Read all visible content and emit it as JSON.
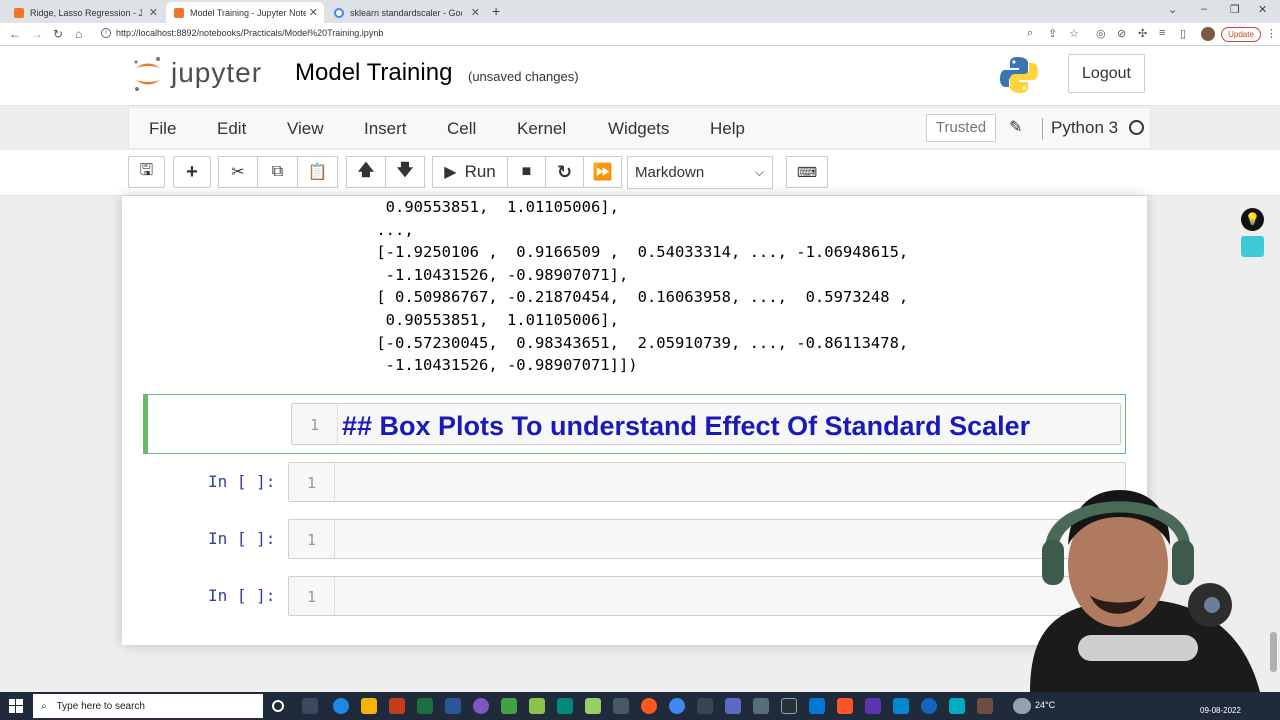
{
  "browser": {
    "tabs": [
      {
        "title": "Ridge, Lasso Regression - Jupyter",
        "active": false
      },
      {
        "title": "Model Training - Jupyter Notebook",
        "active": true
      },
      {
        "title": "sklearn standardscaler - Google S",
        "active": false
      }
    ],
    "url": "http://localhost:8892/notebooks/Practicals/Model%20Training.ipynb",
    "update_label": "Update"
  },
  "header": {
    "logo_text": "jupyter",
    "notebook_title": "Model Training",
    "save_status": "(unsaved changes)",
    "logout_label": "Logout"
  },
  "menubar": {
    "items": [
      "File",
      "Edit",
      "View",
      "Insert",
      "Cell",
      "Kernel",
      "Widgets",
      "Help"
    ],
    "trusted_label": "Trusted",
    "kernel_name": "Python 3"
  },
  "toolbar": {
    "run_label": "Run",
    "cell_type": "Markdown"
  },
  "output": {
    "lines": [
      "  0.90553851,  1.01105006],",
      " ...,",
      " [-1.9250106 ,  0.9166509 ,  0.54033314, ..., -1.06948615,",
      "  -1.10431526, -0.98907071],",
      " [ 0.50986767, -0.21870454,  0.16063958, ...,  0.5973248 ,",
      "  0.90553851,  1.01105006],",
      " [-0.57230045,  0.98343651,  2.05910739, ..., -0.86113478,",
      "  -1.10431526, -0.98907071]])"
    ]
  },
  "cells": {
    "markdown": {
      "line_number": "1",
      "source": "## Box Plots To understand Effect Of Standard Scaler"
    },
    "code": [
      {
        "prompt": "In [ ]:",
        "line_number": "1"
      },
      {
        "prompt": "In [ ]:",
        "line_number": "1"
      },
      {
        "prompt": "In [ ]:",
        "line_number": "1"
      }
    ]
  },
  "taskbar": {
    "search_placeholder": "Type here to search",
    "temperature": "24°C",
    "date": "09-08-2022"
  },
  "colors": {
    "markdown_heading": "#1a1ab8",
    "prompt": "#303f9f",
    "selected_cell_border": "#66bb6a",
    "taskbar": "#1f2a3a"
  }
}
